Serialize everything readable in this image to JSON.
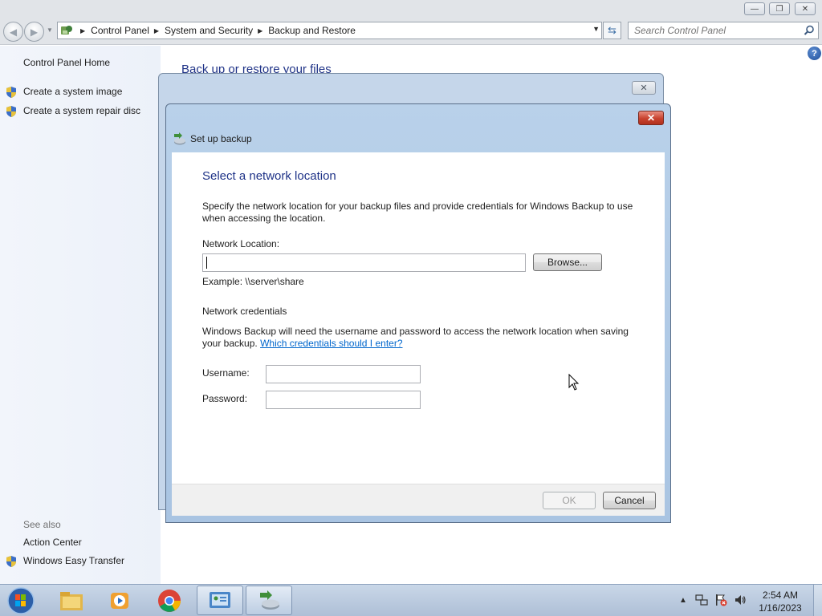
{
  "window": {
    "minimize_glyph": "—",
    "restore_glyph": "❐",
    "close_glyph": "✕"
  },
  "address": {
    "crumbs": [
      "Control Panel",
      "System and Security",
      "Backup and Restore"
    ],
    "search_placeholder": "Search Control Panel"
  },
  "left_pane": {
    "home": "Control Panel Home",
    "tasks": [
      "Create a system image",
      "Create a system repair disc"
    ],
    "see_also_title": "See also",
    "see_also": [
      "Action Center",
      "Windows Easy Transfer"
    ]
  },
  "content": {
    "heading": "Back up or restore your files"
  },
  "dialog": {
    "title": "Set up backup",
    "heading": "Select a network location",
    "description": "Specify the network location for your backup files and provide credentials for Windows Backup to use when accessing the location.",
    "network_location_label": "Network Location:",
    "network_location_value": "",
    "browse_label": "Browse...",
    "example": "Example: \\\\server\\share",
    "credentials_heading": "Network credentials",
    "credentials_text": "Windows Backup will need the username and password to access the network location when saving your backup.",
    "credentials_link": "Which credentials should I enter?",
    "username_label": "Username:",
    "password_label": "Password:",
    "username_value": "",
    "password_value": "",
    "ok_label": "OK",
    "cancel_label": "Cancel"
  },
  "taskbar": {
    "items": [
      {
        "name": "windows-explorer",
        "icon": "folder-icon"
      },
      {
        "name": "windows-media-player",
        "icon": "media-player-icon"
      },
      {
        "name": "google-chrome",
        "icon": "chrome-icon"
      },
      {
        "name": "control-panel",
        "icon": "control-panel-icon",
        "active": true
      },
      {
        "name": "backup-and-restore",
        "icon": "backup-icon",
        "active": true
      }
    ],
    "clock_time": "2:54 AM",
    "clock_date": "1/16/2023"
  },
  "colors": {
    "heading_blue": "#1e3287",
    "link_blue": "#0066cc",
    "dialog_frame": "#b9d1ea",
    "left_pane": "#eef2fa",
    "taskbar": "#b8c8dc"
  }
}
